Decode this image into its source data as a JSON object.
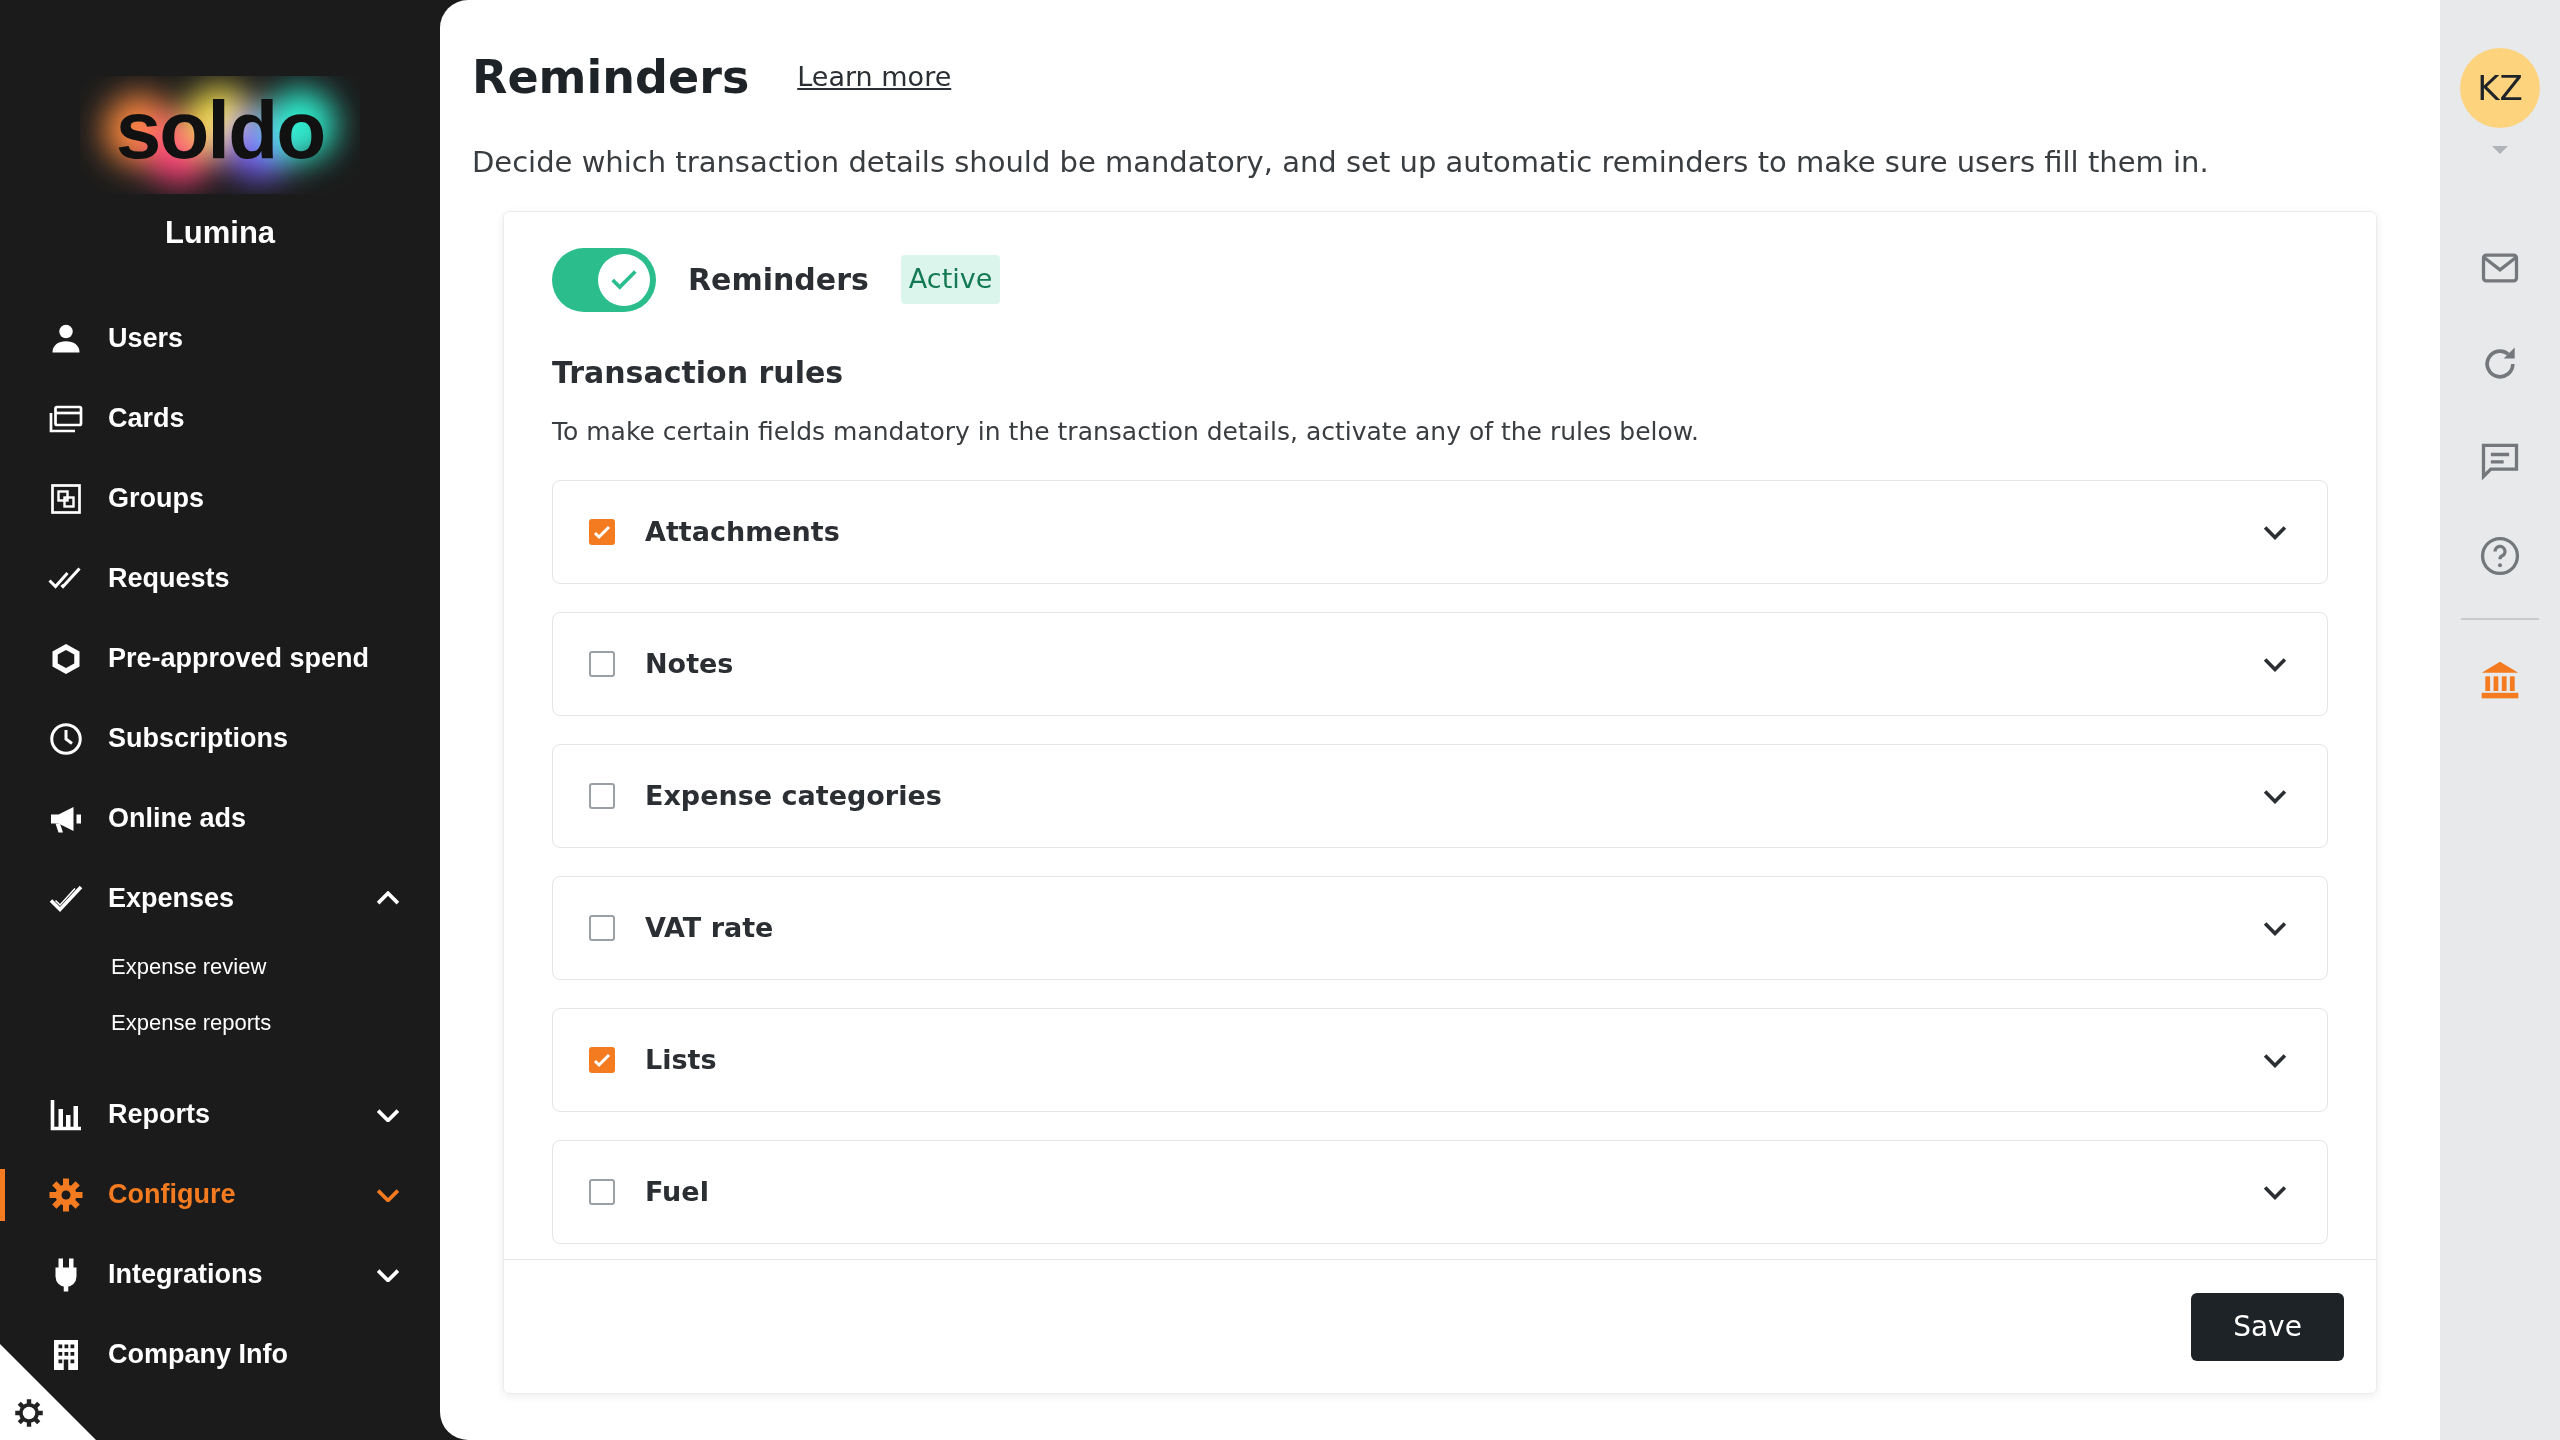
{
  "sidebar": {
    "logo": "soldo",
    "company": "Lumina",
    "items": [
      {
        "label": "Users",
        "selected": false
      },
      {
        "label": "Cards",
        "selected": false
      },
      {
        "label": "Groups",
        "selected": false
      },
      {
        "label": "Requests",
        "selected": false
      },
      {
        "label": "Pre-approved spend",
        "selected": false
      },
      {
        "label": "Subscriptions",
        "selected": false
      },
      {
        "label": "Online ads",
        "selected": false
      },
      {
        "label": "Expenses",
        "selected": false,
        "expanded": true,
        "children": [
          {
            "label": "Expense review"
          },
          {
            "label": "Expense reports"
          }
        ]
      },
      {
        "label": "Reports",
        "selected": false,
        "expanded": false
      },
      {
        "label": "Configure",
        "selected": true,
        "expanded": false
      },
      {
        "label": "Integrations",
        "selected": false,
        "expanded": false
      },
      {
        "label": "Company Info",
        "selected": false
      }
    ]
  },
  "page": {
    "title": "Reminders",
    "learn_more": "Learn more",
    "description": "Decide which transaction details should be mandatory, and set up automatic reminders to make sure users fill them in."
  },
  "card": {
    "toggle": {
      "label": "Reminders",
      "on": true
    },
    "status": "Active",
    "section_title": "Transaction rules",
    "section_description": "To make certain fields mandatory in the transaction details, activate any of the rules below.",
    "rules": [
      {
        "label": "Attachments",
        "checked": true
      },
      {
        "label": "Notes",
        "checked": false
      },
      {
        "label": "Expense categories",
        "checked": false
      },
      {
        "label": "VAT rate",
        "checked": false
      },
      {
        "label": "Lists",
        "checked": true
      },
      {
        "label": "Fuel",
        "checked": false
      }
    ],
    "save": "Save"
  },
  "right_rail": {
    "avatar": "KZ"
  }
}
